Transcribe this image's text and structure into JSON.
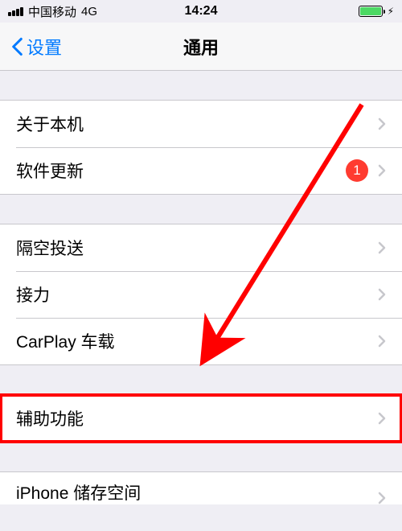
{
  "status": {
    "carrier": "中国移动",
    "network": "4G",
    "time": "14:24"
  },
  "nav": {
    "back_label": "设置",
    "title": "通用"
  },
  "sections": {
    "about": "关于本机",
    "software_update": "软件更新",
    "airdrop": "隔空投送",
    "handoff": "接力",
    "carplay": "CarPlay 车载",
    "accessibility": "辅助功能",
    "storage": "iPhone 储存空间"
  },
  "badges": {
    "software_update": "1"
  },
  "colors": {
    "accent": "#007aff",
    "badge": "#ff3b30",
    "annotation": "#ff0000"
  }
}
